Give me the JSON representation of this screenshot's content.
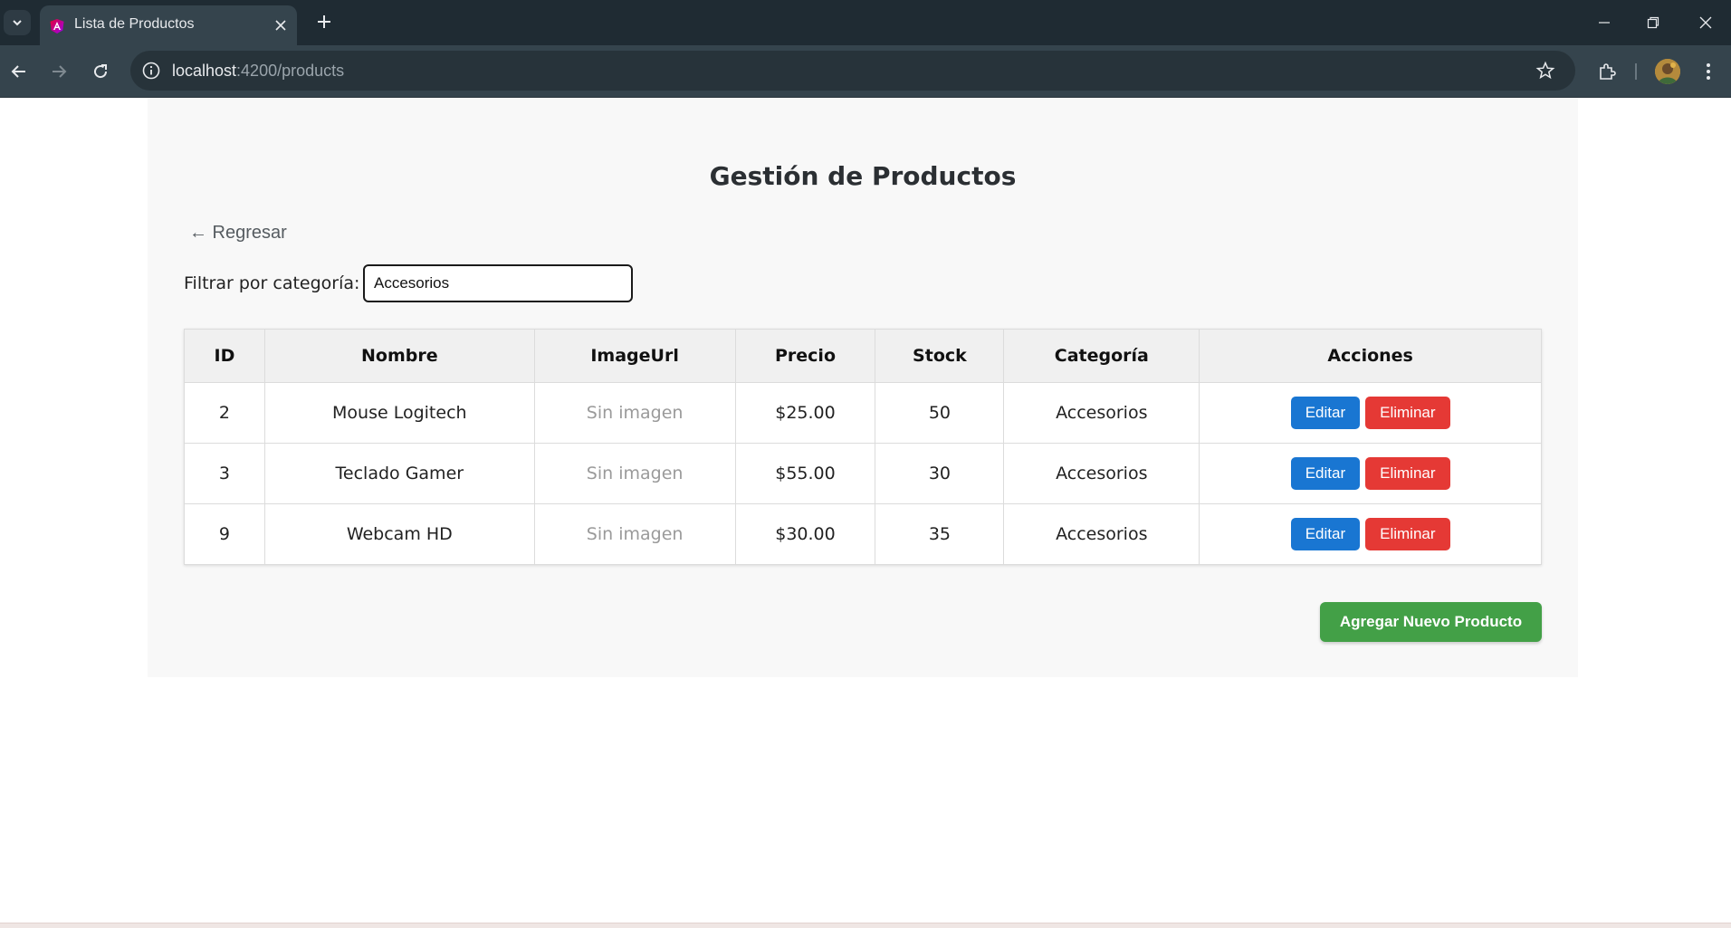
{
  "browser": {
    "tab_title": "Lista de Productos",
    "url_host": "localhost",
    "url_path": ":4200/products",
    "icons": [
      "tab-search-icon",
      "angular-favicon-icon",
      "close-icon",
      "plus-icon",
      "minimize-icon",
      "restore-icon",
      "window-close-icon",
      "back-arrow-icon",
      "forward-arrow-icon",
      "reload-icon",
      "site-info-icon",
      "star-icon",
      "extensions-icon",
      "avatar",
      "kebab-menu-icon"
    ]
  },
  "page": {
    "title": "Gestión de Productos",
    "back_link": "← Regresar",
    "filter": {
      "label": "Filtrar por categoría:",
      "value": "Accesorios"
    },
    "table": {
      "headers": [
        "ID",
        "Nombre",
        "ImageUrl",
        "Precio",
        "Stock",
        "Categoría",
        "Acciones"
      ],
      "rows": [
        {
          "id": "2",
          "name": "Mouse Logitech",
          "image": "Sin imagen",
          "price": "$25.00",
          "stock": "50",
          "category": "Accesorios"
        },
        {
          "id": "3",
          "name": "Teclado Gamer",
          "image": "Sin imagen",
          "price": "$55.00",
          "stock": "30",
          "category": "Accesorios"
        },
        {
          "id": "9",
          "name": "Webcam HD",
          "image": "Sin imagen",
          "price": "$30.00",
          "stock": "35",
          "category": "Accesorios"
        }
      ],
      "edit_label": "Editar",
      "delete_label": "Eliminar"
    },
    "add_button": "Agregar Nuevo Producto"
  },
  "colors": {
    "edit": "#1976d2",
    "delete": "#e53935",
    "add": "#43a047",
    "chrome_dark": "#1f2b33"
  }
}
